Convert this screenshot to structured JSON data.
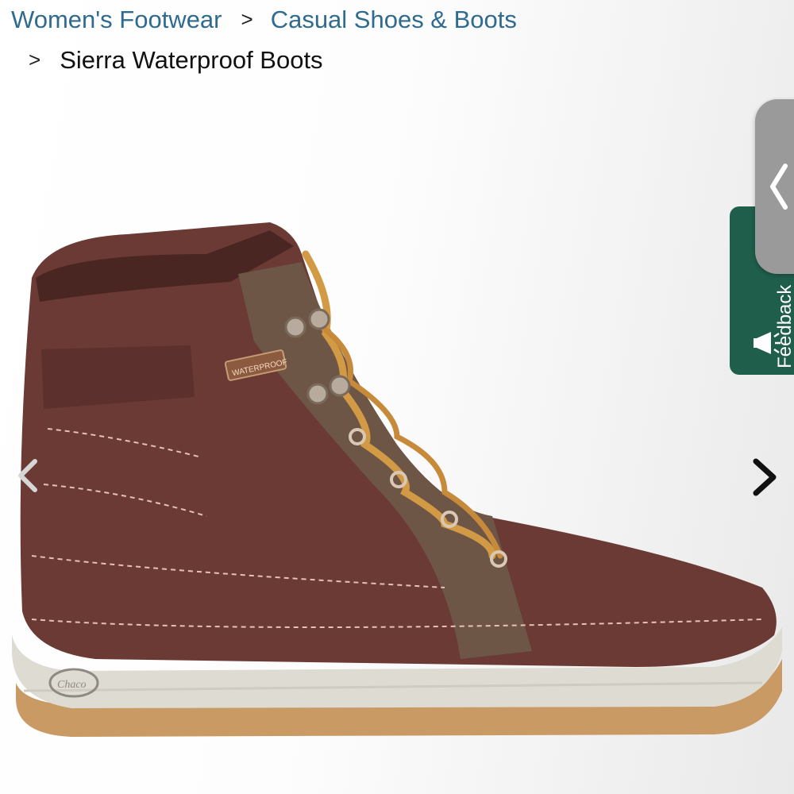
{
  "breadcrumb": {
    "items": [
      "Women's Footwear",
      "Casual Shoes & Boots"
    ],
    "separator": ">",
    "current": "Sierra Waterproof Boots"
  },
  "product_image": {
    "badge_text": "WATERPROOF",
    "logo_text": "Chaco"
  },
  "feedback": {
    "label": "Feedback",
    "icon": "megaphone-icon"
  },
  "carousel": {
    "prev_icon": "chevron-left-icon",
    "next_icon": "chevron-right-icon"
  },
  "colors": {
    "link": "#2f6b8f",
    "feedback_bg": "#1f5e4a",
    "boot_leather": "#6b3a35"
  }
}
